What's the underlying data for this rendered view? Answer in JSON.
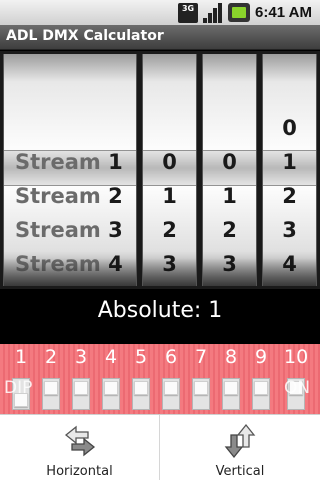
{
  "status_bar": {
    "network": "3G",
    "icons": [
      "3g-icon",
      "signal-icon",
      "battery-icon"
    ],
    "time": "6:41 AM"
  },
  "app": {
    "title": "ADL DMX Calculator"
  },
  "picker": {
    "label_column": [
      {
        "word": "Stream",
        "number": "1"
      },
      {
        "word": "Stream",
        "number": "2"
      },
      {
        "word": "Stream",
        "number": "3"
      },
      {
        "word": "Stream",
        "number": "4"
      }
    ],
    "wheels": [
      {
        "items": [
          "",
          "0",
          "1",
          "2",
          "3"
        ]
      },
      {
        "items": [
          "",
          "0",
          "1",
          "2",
          "3"
        ]
      },
      {
        "items": [
          "0",
          "1",
          "2",
          "3",
          "4"
        ]
      }
    ],
    "selected": {
      "stream": "1",
      "digits": [
        "0",
        "0",
        "1"
      ]
    }
  },
  "absolute": {
    "text": "Absolute: 1"
  },
  "dip_switch": {
    "numbers": [
      "1",
      "2",
      "3",
      "4",
      "5",
      "6",
      "7",
      "8",
      "9",
      "10"
    ],
    "states": [
      "on",
      "off",
      "off",
      "off",
      "off",
      "off",
      "off",
      "off",
      "off",
      "off"
    ],
    "edge_left": "DIP",
    "edge_right": "ON"
  },
  "buttons": {
    "horizontal": {
      "label": "Horizontal",
      "icon": "horizontal-arrows-icon"
    },
    "vertical": {
      "label": "Vertical",
      "icon": "vertical-arrows-icon"
    }
  },
  "colors": {
    "dip_red": "#f06f76",
    "title_bar": "#4f4f4f",
    "battery_green": "#8ad32b"
  }
}
